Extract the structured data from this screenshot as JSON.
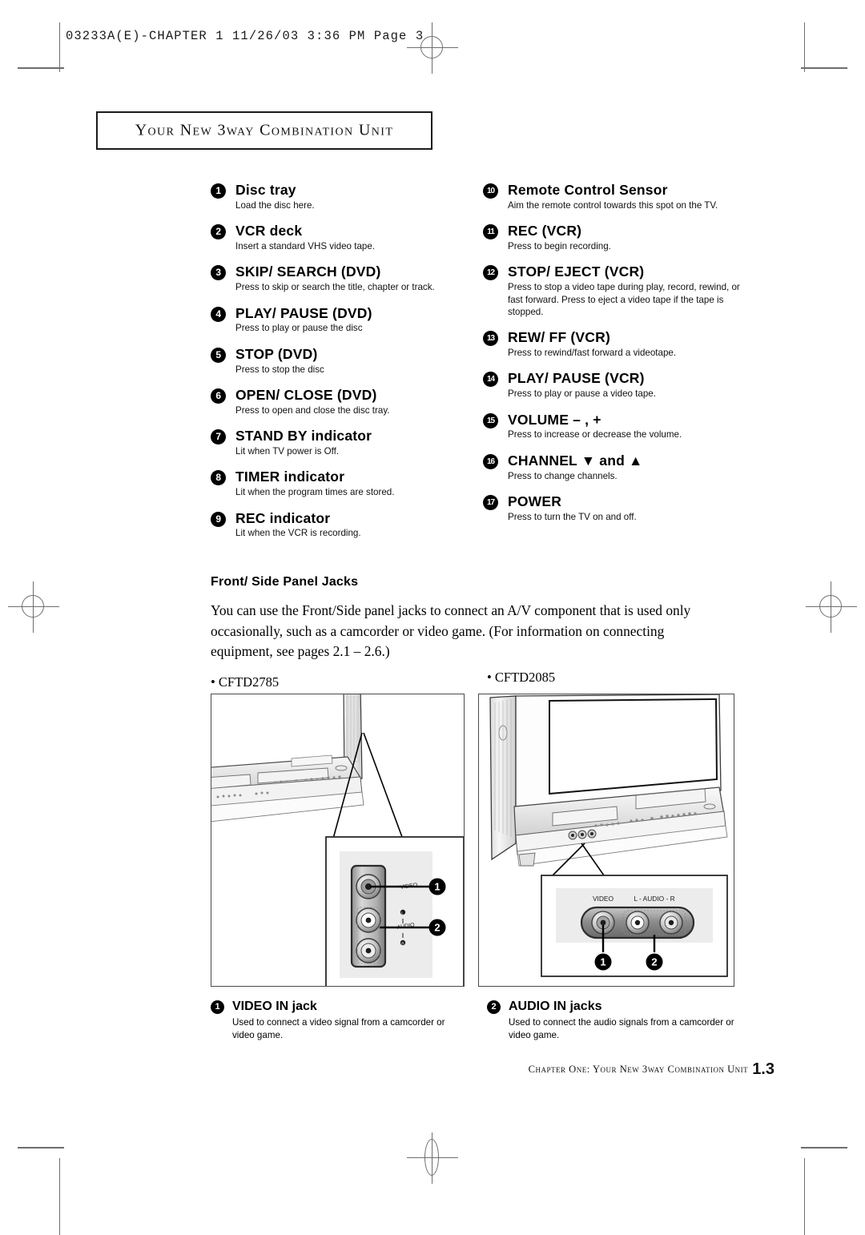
{
  "page_header": "03233A(E)-CHAPTER 1   11/26/03  3:36 PM  Page 3",
  "title": "Your New 3way Combination Unit",
  "features_left": [
    {
      "num": "1",
      "heading": "Disc tray",
      "desc": "Load the disc here."
    },
    {
      "num": "2",
      "heading": "VCR deck",
      "desc": "Insert a standard VHS video tape."
    },
    {
      "num": "3",
      "heading": "SKIP/ SEARCH (DVD)",
      "desc": "Press to skip or search the title, chapter or track."
    },
    {
      "num": "4",
      "heading": "PLAY/ PAUSE (DVD)",
      "desc": "Press to play or pause the disc"
    },
    {
      "num": "5",
      "heading": "STOP (DVD)",
      "desc": "Press to stop the disc"
    },
    {
      "num": "6",
      "heading": "OPEN/ CLOSE (DVD)",
      "desc": "Press to open and close the disc tray."
    },
    {
      "num": "7",
      "heading": "STAND BY indicator",
      "desc": "Lit when TV power is Off."
    },
    {
      "num": "8",
      "heading": "TIMER indicator",
      "desc": "Lit when the program times are stored."
    },
    {
      "num": "9",
      "heading": "REC indicator",
      "desc": "Lit when the VCR is recording."
    }
  ],
  "features_right": [
    {
      "num": "10",
      "heading": "Remote Control Sensor",
      "desc": "Aim the remote control towards this spot on the TV."
    },
    {
      "num": "11",
      "heading": "REC (VCR)",
      "desc": "Press to begin recording."
    },
    {
      "num": "12",
      "heading": "STOP/ EJECT (VCR)",
      "desc": "Press to stop a video tape during play, record, rewind, or fast forward. Press to eject a video tape if the tape is stopped."
    },
    {
      "num": "13",
      "heading": "REW/ FF (VCR)",
      "desc": "Press to rewind/fast forward a videotape."
    },
    {
      "num": "14",
      "heading": "PLAY/ PAUSE (VCR)",
      "desc": "Press to play or pause a video tape."
    },
    {
      "num": "15",
      "heading": "VOLUME – , +",
      "desc": "Press to increase or decrease the volume."
    },
    {
      "num": "16",
      "heading": "CHANNEL ▼ and ▲",
      "desc": "Press to change channels."
    },
    {
      "num": "17",
      "heading": "POWER",
      "desc": "Press to turn the TV on and off."
    }
  ],
  "section": {
    "heading": "Front/ Side Panel Jacks",
    "paragraph": "You can use the Front/Side panel jacks to connect an A/V component that is used only occasionally, such as a camcorder or video game. (For information on connecting equipment, see pages 2.1 – 2.6.)"
  },
  "models": {
    "left": "• CFTD2785",
    "right": "• CFTD2085"
  },
  "illustration_left": {
    "callout_video_label": "VIDEO",
    "callout_audio_label": "AUDIO",
    "callout_numbers": [
      "1",
      "2"
    ]
  },
  "illustration_right": {
    "callout_video_label": "VIDEO",
    "callout_audio_label": "L - AUDIO - R",
    "callout_numbers": [
      "1",
      "2"
    ]
  },
  "captions": [
    {
      "num": "1",
      "heading": "VIDEO IN jack",
      "desc": "Used to connect a video signal from a camcorder or video game."
    },
    {
      "num": "2",
      "heading": "AUDIO IN jacks",
      "desc": "Used to connect the audio signals from a camcorder or video game."
    }
  ],
  "footer": {
    "text": "Chapter One: Your New 3way Combination Unit",
    "page_number": "1.3"
  },
  "colors": {
    "ink": "#000000",
    "mark_gray": "#6e6e6e",
    "panel_gray": "#d8d8d8"
  }
}
